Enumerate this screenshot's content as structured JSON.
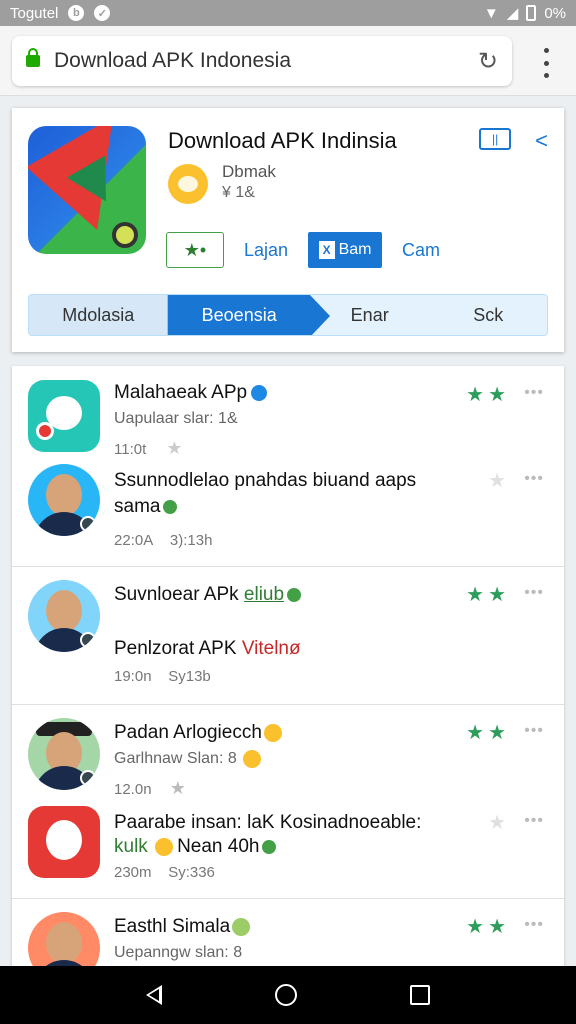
{
  "status_bar": {
    "carrier": "Togutel",
    "battery": "0%"
  },
  "browser": {
    "url": "Download APK Indonesia",
    "reload_icon": "reload-icon",
    "menu_icon": "kebab-menu-icon"
  },
  "app_header": {
    "title": "Download APK Indinsia",
    "developer": "Dbmak",
    "developer_sub": "¥ 1&",
    "actions": {
      "rate": "★•",
      "learn": "Lajan",
      "primary": "Bam",
      "primary_mark": "X",
      "secondary": "Cam"
    },
    "tabs": [
      "Mdolasia",
      "Beoensia",
      "Enar",
      "Sck"
    ]
  },
  "list": {
    "items": [
      {
        "name": "Malahaeak APp",
        "sub": "Uapulaar slar: 1&",
        "meta": "11:0t",
        "stars": "★★",
        "dots": "•••"
      },
      {
        "name": "Ssunnodlelao pnahdas biuand aaps",
        "name2": "sama",
        "meta_time": "22:0A",
        "meta_size": "3):13h",
        "stars": "★",
        "dots": "•••"
      },
      {
        "name": "Suvnloear APk",
        "name_tag": "eliub",
        "sub": "Penlzorat APK",
        "sub_red": "Vitelnø",
        "meta_time": "19:0n",
        "meta_size": "Sy13b",
        "stars": "★★",
        "dots": "•••"
      },
      {
        "name": "Padan Arlogiecch",
        "sub": "Garlhnaw Slan: 8",
        "meta": "12.0n",
        "stars": "★★",
        "dots": "•••"
      },
      {
        "name": "Paarabe insan: laK Kosinadnoeable:",
        "sub_green": "kulk",
        "sub": "Nean 40h",
        "meta_time": "230m",
        "meta_size": "Sy:336",
        "stars": "★",
        "dots": "•••"
      },
      {
        "name": "Easthl Simala",
        "sub": "Uepanngw slan: 8",
        "stars": "★★",
        "dots": "•••"
      }
    ]
  },
  "colors": {
    "accent": "#1976d2",
    "star": "#2e9d5b",
    "status_bar": "#9e9e9e"
  }
}
